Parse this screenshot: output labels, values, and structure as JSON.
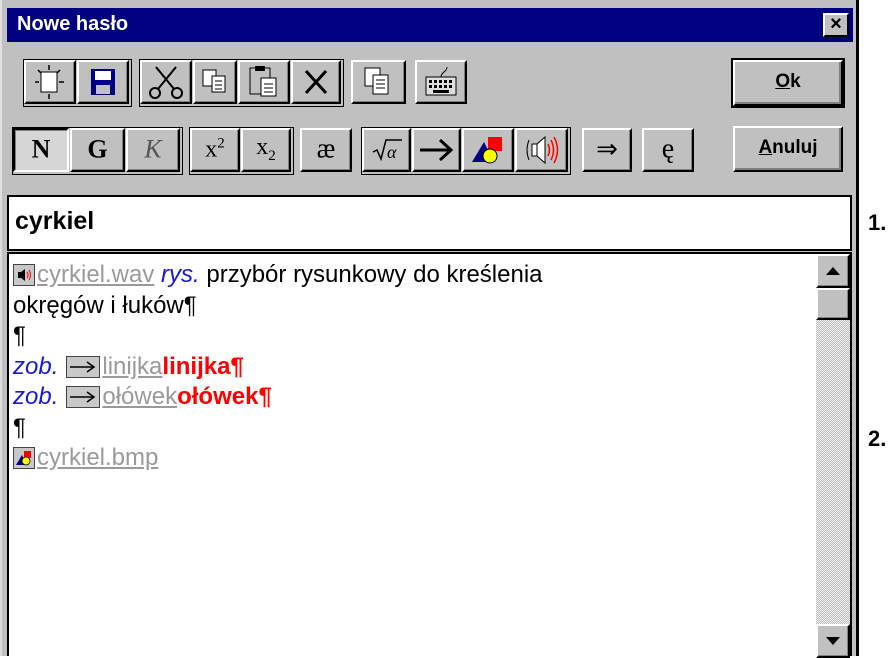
{
  "window": {
    "title": "Nowe hasło"
  },
  "toolbar": {
    "bold_label": "N",
    "strong_label": "G",
    "italic_label": "K",
    "superscript_base": "x",
    "superscript_exp": "2",
    "subscript_base": "x",
    "subscript_exp": "2",
    "ligature_label": "æ",
    "double_arrow_label": "⇒",
    "special_char_label": "ę"
  },
  "buttons": {
    "ok_mnemonic": "O",
    "ok_rest": "k",
    "cancel_mnemonic": "A",
    "cancel_rest": "nuluj"
  },
  "entry": {
    "headword": "cyrkiel"
  },
  "content": {
    "sound_file": "cyrkiel.wav",
    "label": "rys.",
    "definition_1": " przybór rysunkowy do kreślenia",
    "definition_2": "okręgów i łuków¶",
    "pilcrow": "¶",
    "see_label": "zob.",
    "ref1_link": "linijka",
    "ref1_target": "linijka¶",
    "ref2_link": "ołówek",
    "ref2_target": "ołówek¶",
    "image_file": "cyrkiel.bmp"
  },
  "side": {
    "item1": "1.",
    "item2": "2."
  }
}
